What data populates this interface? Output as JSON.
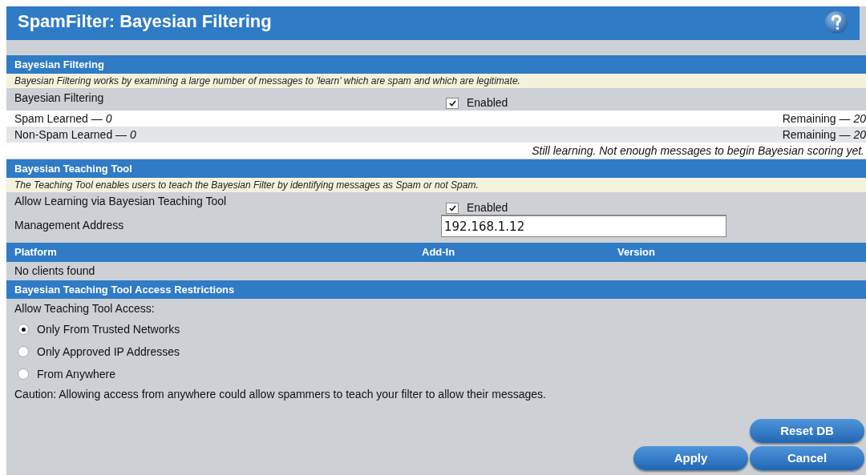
{
  "title": "SpamFilter: Bayesian Filtering",
  "filtering": {
    "header": "Bayesian Filtering",
    "description": "Bayesian Filtering works by examining a large number of messages to 'learn' which are spam and which are legitimate.",
    "setting": {
      "label": "Bayesian Filtering",
      "checked": true,
      "option": "Enabled"
    },
    "counts": [
      {
        "label": "Spam Learned — *0*",
        "remaining": "Remaining — *20*"
      },
      {
        "label": "Non-Spam Learned — *0*",
        "remaining": "Remaining — *20*"
      }
    ],
    "status": "Still learning. Not enough messages to begin Bayesian scoring yet."
  },
  "teaching": {
    "header": "Bayesian Teaching Tool",
    "description": "The Teaching Tool enables users to teach the Bayesian Filter by identifying messages as Spam or not Spam.",
    "setting": {
      "label": "Allow Learning via Bayesian Teaching Tool",
      "checked": true,
      "option": "Enabled"
    },
    "address": {
      "label": "Management Address",
      "value": "192.168.1.12"
    }
  },
  "clients": {
    "columns": [
      "Platform",
      "Add-In",
      "Version"
    ],
    "empty": "No clients found"
  },
  "access": {
    "header": "Bayesian Teaching Tool Access Restrictions",
    "label": "Allow Teaching Tool Access:",
    "options": [
      {
        "label": "Only From Trusted Networks",
        "selected": true
      },
      {
        "label": "Only Approved IP Addresses",
        "selected": false
      },
      {
        "label": "From Anywhere",
        "selected": false
      }
    ],
    "caution": "Caution: Allowing access from anywhere could allow spammers to teach your filter to allow their messages."
  },
  "buttons": {
    "reset": "Reset DB",
    "apply": "Apply",
    "cancel": "Cancel"
  }
}
